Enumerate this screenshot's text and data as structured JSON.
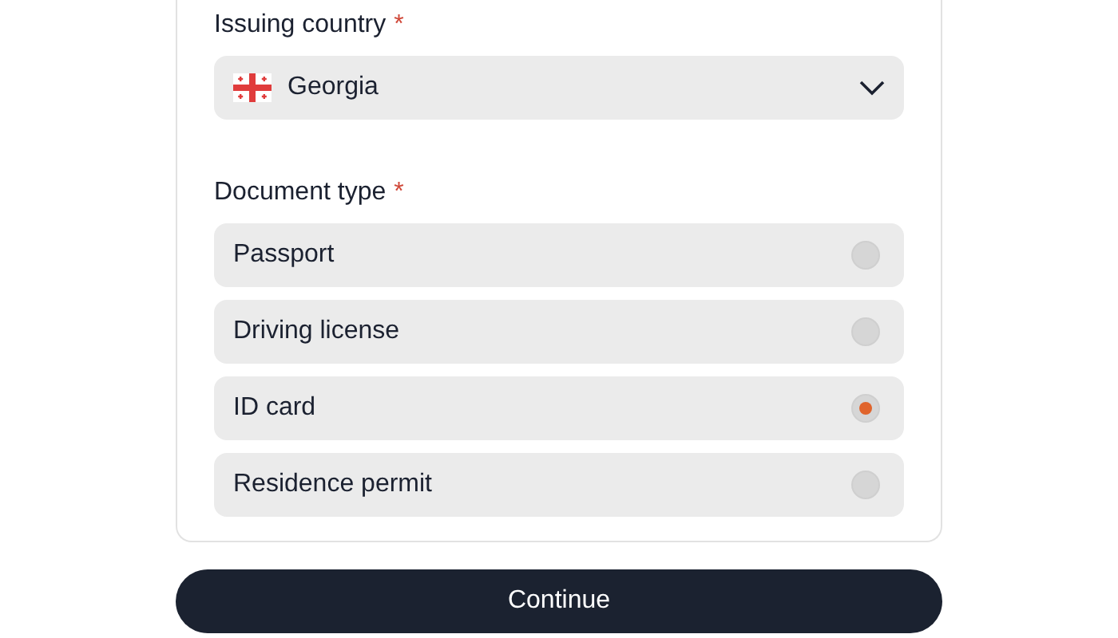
{
  "issuing_country": {
    "label": "Issuing country",
    "required_mark": "*",
    "value": "Georgia"
  },
  "document_type": {
    "label": "Document type",
    "required_mark": "*",
    "options": [
      {
        "label": "Passport",
        "selected": false
      },
      {
        "label": "Driving license",
        "selected": false
      },
      {
        "label": "ID card",
        "selected": true
      },
      {
        "label": "Residence permit",
        "selected": false
      }
    ]
  },
  "continue_button": "Continue"
}
